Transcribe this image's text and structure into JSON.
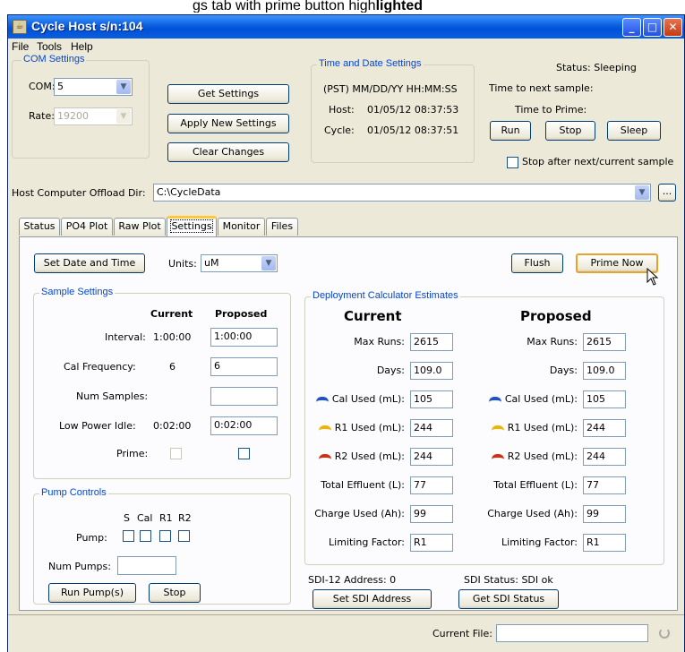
{
  "caption": {
    "prefix": "",
    "rest": "gs tab with prime button high",
    "bold": "lighted"
  },
  "window": {
    "title": "Cycle Host s/n:104",
    "minimize": "_",
    "maximize": "□",
    "close": "✕"
  },
  "menu": [
    "File",
    "Tools",
    "Help"
  ],
  "com_settings": {
    "legend": "COM Settings",
    "com_label": "COM:",
    "com_value": "5",
    "rate_label": "Rate:",
    "rate_value": "19200"
  },
  "buttons": {
    "get_settings": "Get Settings",
    "apply_new_settings": "Apply New Settings",
    "clear_changes": "Clear Changes"
  },
  "time_date": {
    "legend": "Time and Date Settings",
    "format": "(PST) MM/DD/YY HH:MM:SS",
    "host_label": "Host:",
    "host_value": "01/05/12 08:37:53",
    "cycle_label": "Cycle:",
    "cycle_value": "01/05/12 08:37:51"
  },
  "status_area": {
    "status": "Status: Sleeping",
    "next_sample": "Time to next sample:",
    "time_to_prime": "Time to Prime:",
    "run": "Run",
    "stop": "Stop",
    "sleep": "Sleep",
    "stop_after": "Stop after next/current sample"
  },
  "offload": {
    "label": "Host Computer Offload Dir:",
    "value": "C:\\CycleData",
    "browse": "..."
  },
  "tabs": [
    "Status",
    "PO4 Plot",
    "Raw Plot",
    "Settings",
    "Monitor",
    "Files"
  ],
  "settings": {
    "set_date_time": "Set Date and Time",
    "units_label": "Units:",
    "units_value": "uM",
    "flush": "Flush",
    "prime_now": "Prime Now",
    "sample_settings": {
      "legend": "Sample Settings",
      "col_current": "Current",
      "col_proposed": "Proposed",
      "rows": [
        {
          "label": "Interval:",
          "current": "1:00:00",
          "proposed": "1:00:00"
        },
        {
          "label": "Cal Frequency:",
          "current": "6",
          "proposed": "6"
        },
        {
          "label": "Num Samples:",
          "current": "",
          "proposed": ""
        },
        {
          "label": "Low Power Idle:",
          "current": "0:02:00",
          "proposed": "0:02:00"
        }
      ],
      "prime_label": "Prime:"
    },
    "pump_controls": {
      "legend": "Pump Controls",
      "cols": [
        "S",
        "Cal",
        "R1",
        "R2"
      ],
      "pump_label": "Pump:",
      "num_pumps_label": "Num Pumps:",
      "num_pumps_value": "",
      "run_pumps": "Run Pump(s)",
      "stop": "Stop"
    },
    "deployment": {
      "legend": "Deployment Calculator Estimates",
      "current_title": "Current",
      "proposed_title": "Proposed",
      "rows": [
        {
          "label": "Max Runs:",
          "current": "2615",
          "proposed": "2615",
          "icon": ""
        },
        {
          "label": "Days:",
          "current": "109.0",
          "proposed": "109.0",
          "icon": ""
        },
        {
          "label": "Cal Used (mL):",
          "current": "105",
          "proposed": "105",
          "icon": "#1e50c8"
        },
        {
          "label": "R1 Used (mL):",
          "current": "244",
          "proposed": "244",
          "icon": "#f0b400"
        },
        {
          "label": "R2 Used (mL):",
          "current": "244",
          "proposed": "244",
          "icon": "#d03010"
        },
        {
          "label": "Total Effluent (L):",
          "current": "77",
          "proposed": "77",
          "icon": ""
        },
        {
          "label": "Charge Used (Ah):",
          "current": "99",
          "proposed": "99",
          "icon": ""
        },
        {
          "label": "Limiting Factor:",
          "current": "R1",
          "proposed": "R1",
          "icon": ""
        }
      ]
    },
    "sdi": {
      "address_label": "SDI-12 Address: 0",
      "status_label": "SDI Status: SDI ok",
      "set_address": "Set SDI Address",
      "get_status": "Get SDI Status"
    }
  },
  "statusbar": {
    "current_file_label": "Current File:",
    "current_file_value": ""
  }
}
